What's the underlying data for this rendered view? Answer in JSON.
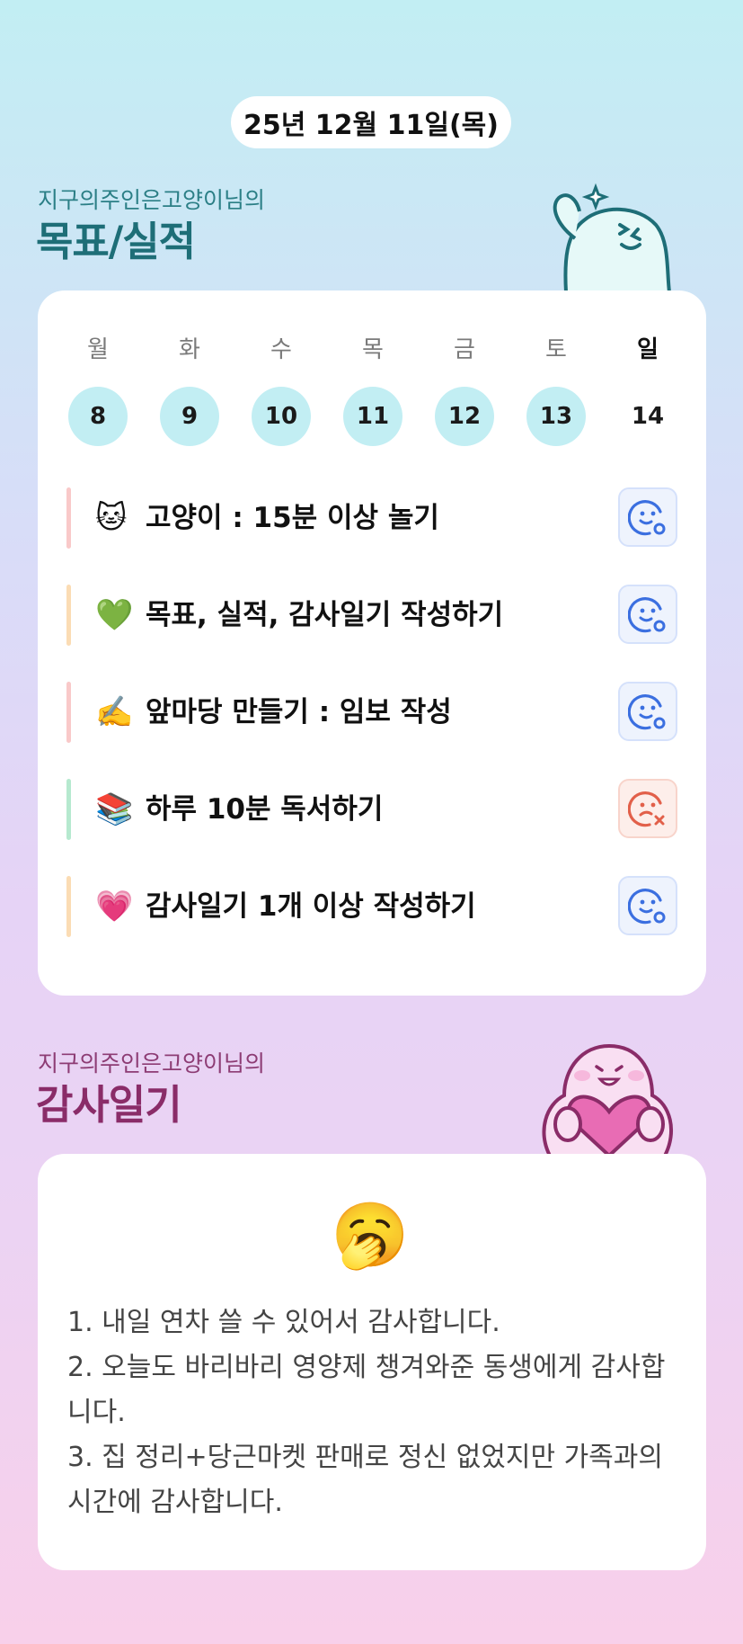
{
  "header": {
    "date": "25년 12월 11일(목)"
  },
  "goals_section": {
    "subtitle": "지구의주인은고양이님의",
    "title": "목표/실적"
  },
  "week": {
    "days": [
      "월",
      "화",
      "수",
      "목",
      "금",
      "토",
      "일"
    ],
    "dates": [
      "8",
      "9",
      "10",
      "11",
      "12",
      "13",
      "14"
    ],
    "completed": [
      true,
      true,
      true,
      true,
      true,
      true,
      false
    ]
  },
  "goals": [
    {
      "emoji": "🐱",
      "text": "고양이 : 15분 이상 놀기",
      "bar_color": "#f9c9c9",
      "status": "success"
    },
    {
      "emoji": "💚",
      "text": "목표, 실적, 감사일기 작성하기",
      "bar_color": "#fbdcb4",
      "status": "success"
    },
    {
      "emoji": "✍️",
      "text": "앞마당 만들기 : 임보 작성",
      "bar_color": "#f9c9c9",
      "status": "success"
    },
    {
      "emoji": "📚",
      "text": "하루 10분 독서하기",
      "bar_color": "#b6e9cf",
      "status": "fail"
    },
    {
      "emoji": "💗",
      "text": "감사일기 1개 이상 작성하기",
      "bar_color": "#fbdcb4",
      "status": "success"
    }
  ],
  "thanks_section": {
    "subtitle": "지구의주인은고양이님의",
    "title": "감사일기",
    "emoji": "🥱",
    "lines": [
      "1. 내일 연차 쓸 수 있어서 감사합니다.",
      "2. 오늘도 바리바리 영양제 챙겨와준 동생에게 감사합니다.",
      "3. 집 정리+당근마켓 판매로 정신 없었지만 가족과의 시간에 감사합니다."
    ]
  },
  "colors": {
    "accent_teal": "#1e6e77",
    "accent_plum": "#8a2c68",
    "success_blue": "#3b6fe0",
    "fail_red": "#e2604a"
  },
  "icons": {
    "success": "smile-check-icon",
    "fail": "frown-x-icon"
  }
}
